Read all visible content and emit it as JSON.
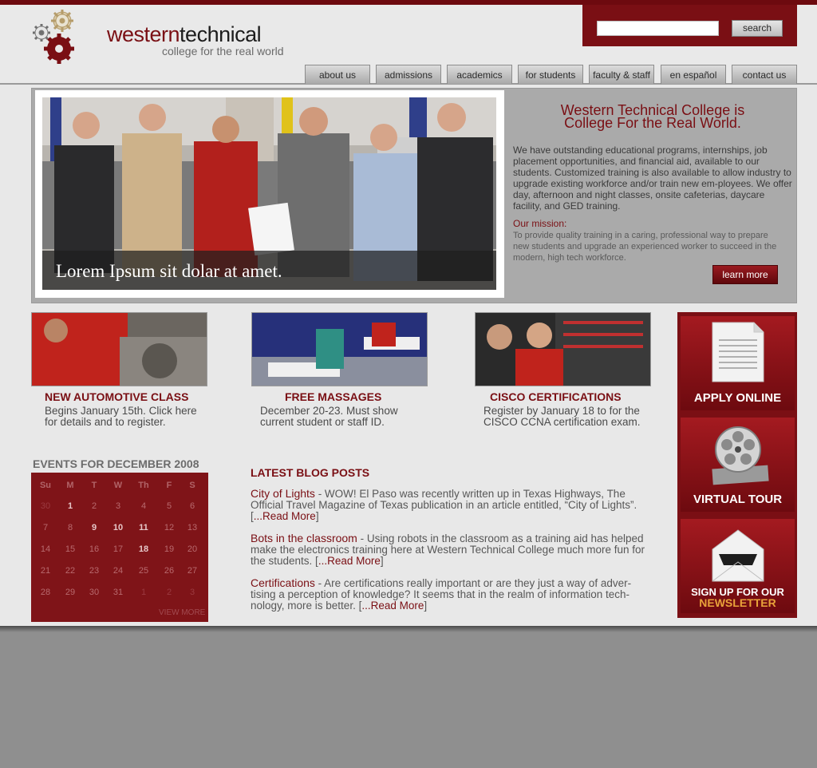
{
  "header": {
    "logo_word_1": "western",
    "logo_word_2": "technical",
    "tagline": "college for the real world"
  },
  "search": {
    "placeholder": "",
    "button_label": "search"
  },
  "nav": [
    "about us",
    "admissions",
    "academics",
    "for students",
    "faculty & staff",
    "en español",
    "contact us"
  ],
  "hero": {
    "caption": "Lorem Ipsum sit dolar at amet.",
    "title_line1": "Western Technical College is",
    "title_line2": "College For the Real World.",
    "body": "We have outstanding educational programs, internships, job placement opportunities, and financial aid, available to our students. Customized training is also available to allow industry to upgrade existing workforce and/or train new em-ployees. We offer day, afternoon and night classes, onsite cafeterias, daycare facility, and GED training.",
    "mission_label": "Our mission:",
    "mission_text": "To provide quality training in a caring, professional way to prepare new students and upgrade an experienced worker to succeed in the modern, high tech workforce.",
    "learn_more": "learn more"
  },
  "features": [
    {
      "title": "NEW AUTOMOTIVE CLASS",
      "line1": "Begins January 15th. Click here",
      "line2": "for details and to register."
    },
    {
      "title": "FREE MASSAGES",
      "line1": "December 20-23.  Must show",
      "line2": "current student or staff ID."
    },
    {
      "title": "CISCO CERTIFICATIONS",
      "line1": "Register by January 18 to for the",
      "line2": "CISCO CCNA certification exam."
    }
  ],
  "events": {
    "title": "EVENTS FOR DECEMBER 2008",
    "days": [
      "Su",
      "M",
      "T",
      "W",
      "Th",
      "F",
      "S"
    ],
    "weeks": [
      [
        "30",
        "1",
        "2",
        "3",
        "4",
        "5",
        "6"
      ],
      [
        "7",
        "8",
        "9",
        "10",
        "11",
        "12",
        "13"
      ],
      [
        "14",
        "15",
        "16",
        "17",
        "18",
        "19",
        "20"
      ],
      [
        "21",
        "22",
        "23",
        "24",
        "25",
        "26",
        "27"
      ],
      [
        "28",
        "29",
        "30",
        "31",
        "1",
        "2",
        "3"
      ]
    ],
    "view_more": "VIEW MORE"
  },
  "blog": {
    "title": "LATEST BLOG POSTS",
    "posts": [
      {
        "title": "City of Lights",
        "text": " - WOW! El Paso was recently written up in Texas Highways, The Official Travel Magazine of Texas publication in an article entitled, “City of Lights”. [",
        "read_more": "...Read More",
        "close": "]"
      },
      {
        "title": "Bots in the classroom",
        "text": " - Using robots in the classroom as a training aid has helped make the electronics training here at Western Technical College much more fun for the students. [",
        "read_more": "...Read More",
        "close": "]"
      },
      {
        "title": "Certifications",
        "text": " - Are certifications really important or are they just a way of adver-tising a perception of knowledge? It seems that in the realm of information tech-nology, more is better. [",
        "read_more": "...Read More",
        "close": "]"
      }
    ]
  },
  "sidebar": {
    "apply": "APPLY ONLINE",
    "tour": "VIRTUAL TOUR",
    "newsletter_line1": "SIGN UP FOR OUR",
    "newsletter_line2": "NEWSLETTER"
  },
  "colors": {
    "brand": "#7a0f14",
    "accent": "#e8a23a"
  }
}
